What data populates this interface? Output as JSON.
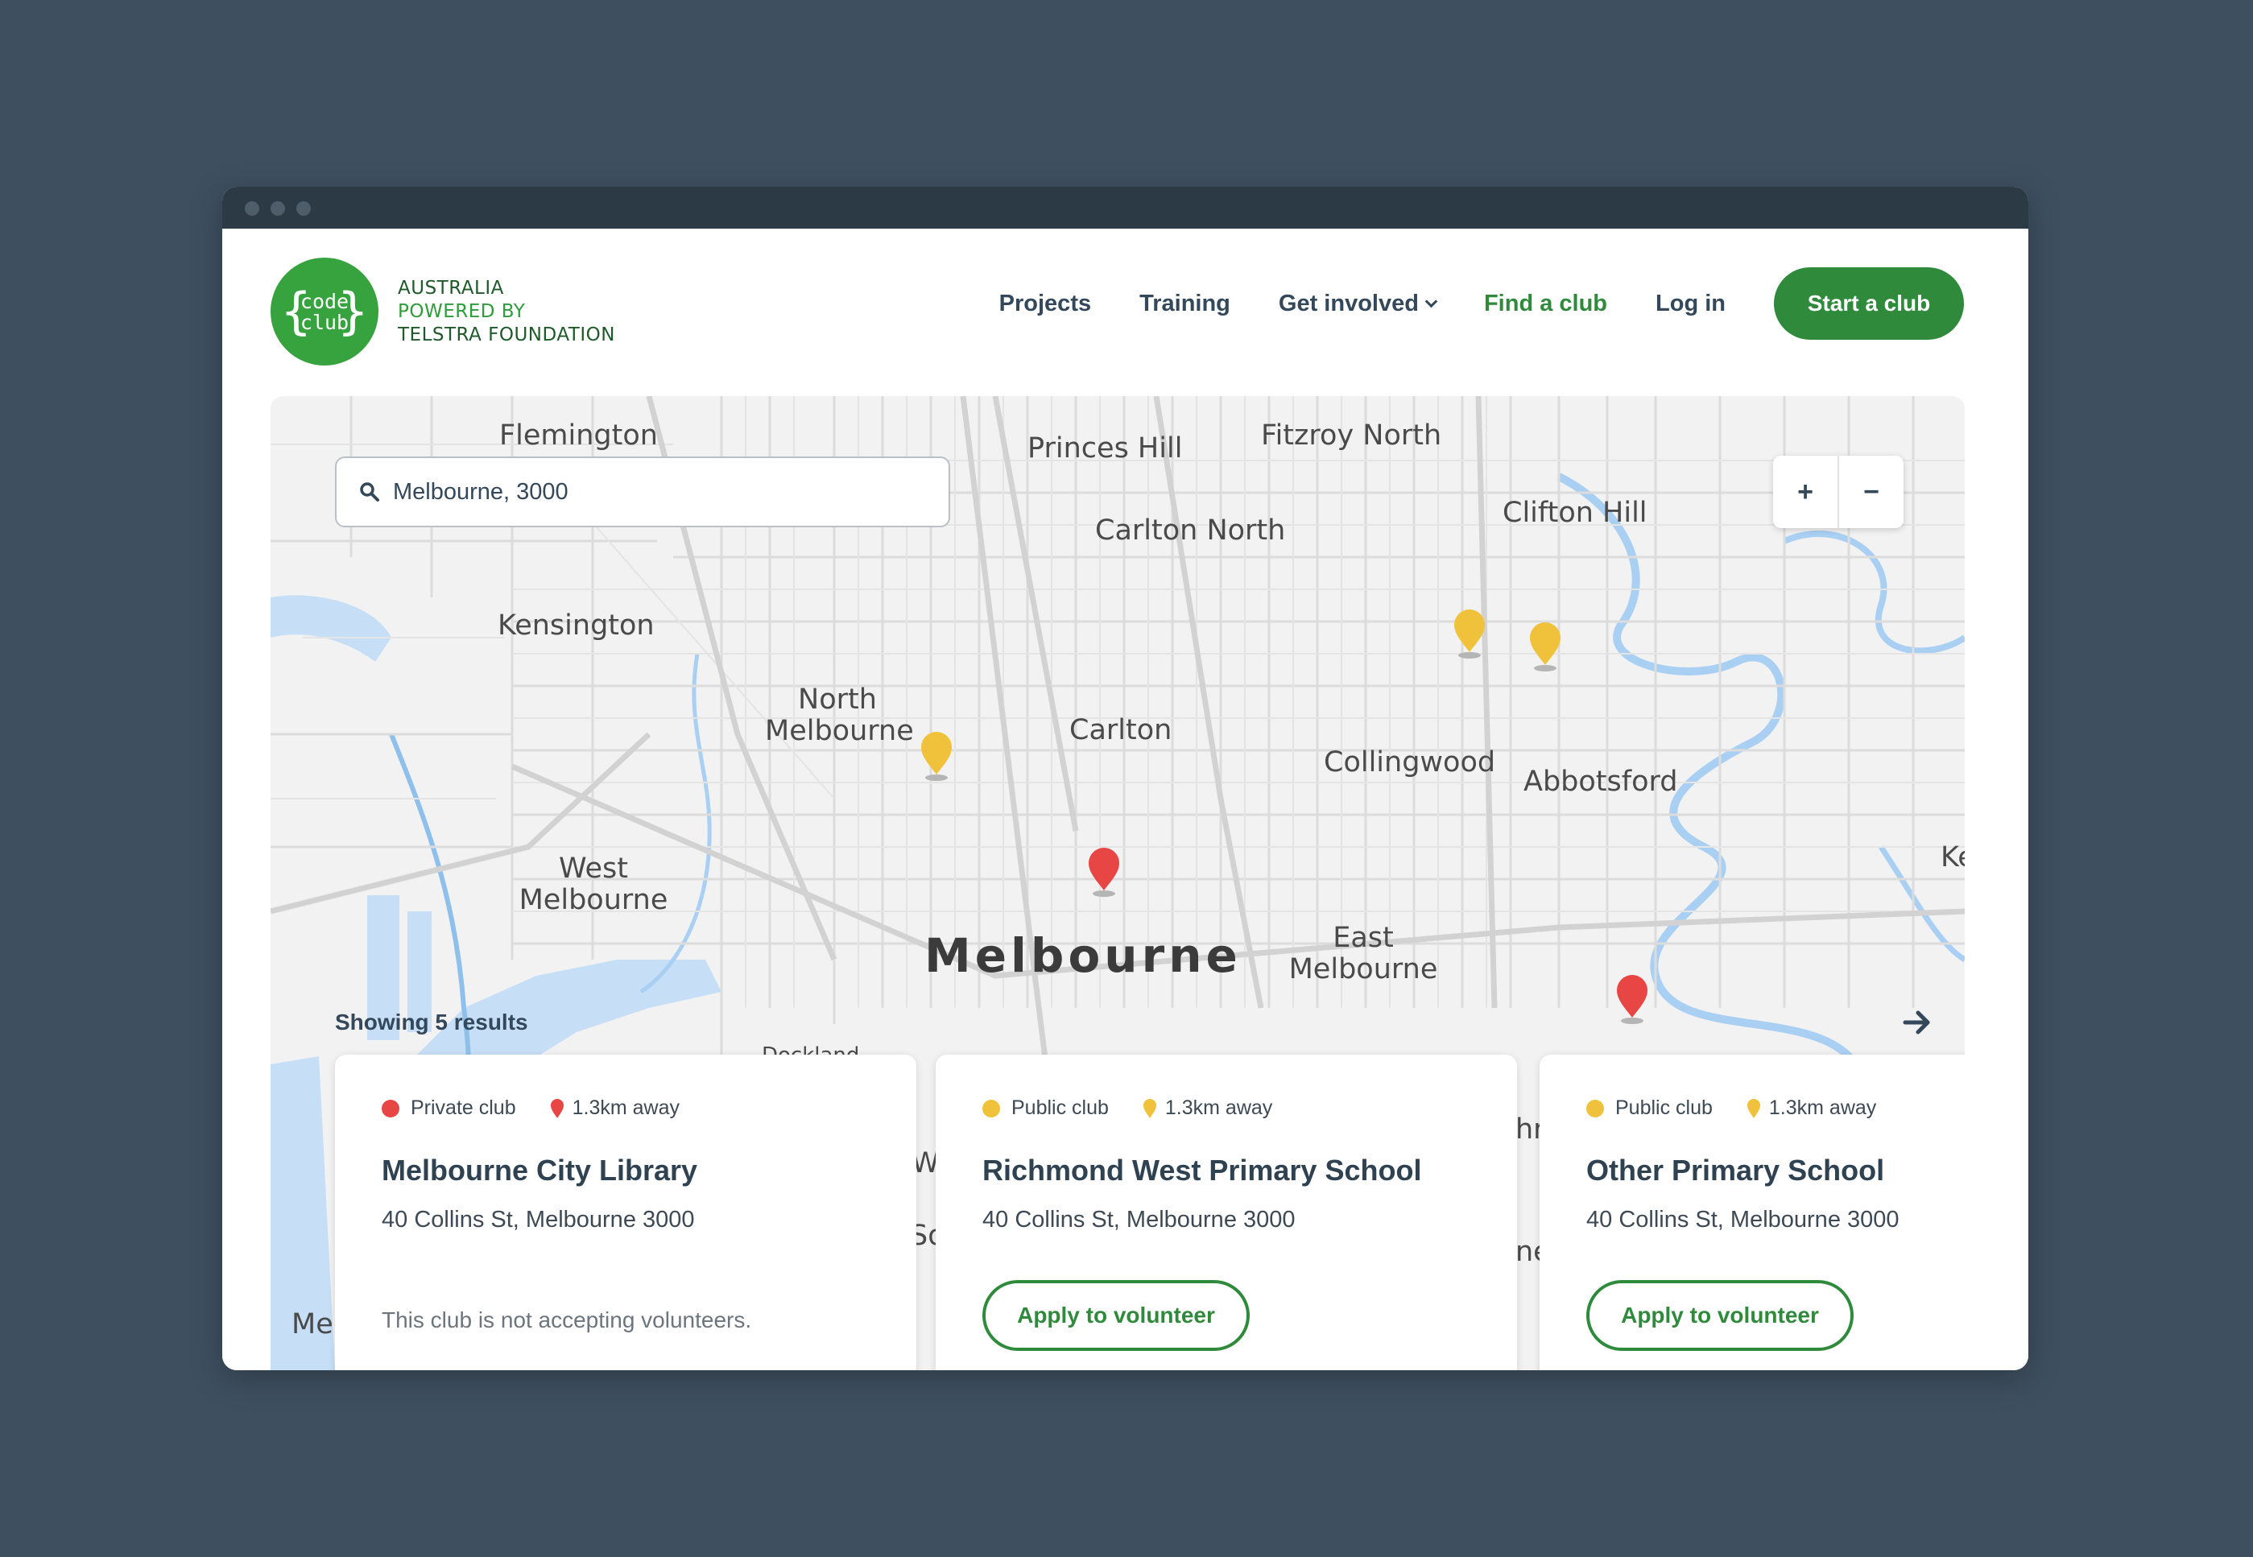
{
  "brand": {
    "logo_word_1": "code",
    "logo_word_2": "club",
    "tagline_1": "AUSTRALIA",
    "tagline_2": "POWERED BY",
    "tagline_3": "TELSTRA FOUNDATION",
    "green": "#2f8a3b"
  },
  "nav": {
    "projects": "Projects",
    "training": "Training",
    "get_involved": "Get involved",
    "find_club": "Find a club",
    "login": "Log in",
    "start_club": "Start a club"
  },
  "search": {
    "value": "Melbourne, 3000",
    "icon": "search-icon"
  },
  "zoom": {
    "in": "+",
    "out": "−"
  },
  "map": {
    "places": {
      "flemington": "Flemington",
      "princes_hill": "Princes Hill",
      "fitzroy_north": "Fitzroy North",
      "clifton_hill": "Clifton Hill",
      "carlton_north": "Carlton North",
      "kensington": "Kensington",
      "north": "North",
      "north_melbourne": "Melbourne",
      "carlton": "Carlton",
      "collingwood": "Collingwood",
      "abbotsford": "Abbotsford",
      "west": "West",
      "west_melbourne": "Melbourne",
      "melbourne": "Melbourne",
      "east": "East",
      "east_melbourne": "Melbourne",
      "partial_k": "Ke",
      "partial_me": "Me",
      "partial_docklands": "Dockland",
      "partial_w": "W",
      "partial_so": "So",
      "partial_h": "hr",
      "partial_ne": "ne"
    },
    "pin_colors": {
      "public": "#f0c23b",
      "private": "#e84545"
    }
  },
  "results": {
    "label": "Showing 5 results"
  },
  "cards": [
    {
      "type": "Private club",
      "distance": "1.3km away",
      "name": "Melbourne City Library",
      "address": "40 Collins St, Melbourne 3000",
      "note": "This club is not accepting volunteers.",
      "color": "#e84545"
    },
    {
      "type": "Public club",
      "distance": "1.3km away",
      "name": "Richmond West Primary School",
      "address": "40 Collins St, Melbourne 3000",
      "cta": "Apply to volunteer",
      "color": "#f0c23b"
    },
    {
      "type": "Public club",
      "distance": "1.3km away",
      "name": "Other Primary School",
      "address": "40 Collins St, Melbourne 3000",
      "cta": "Apply to volunteer",
      "color": "#f0c23b"
    }
  ]
}
